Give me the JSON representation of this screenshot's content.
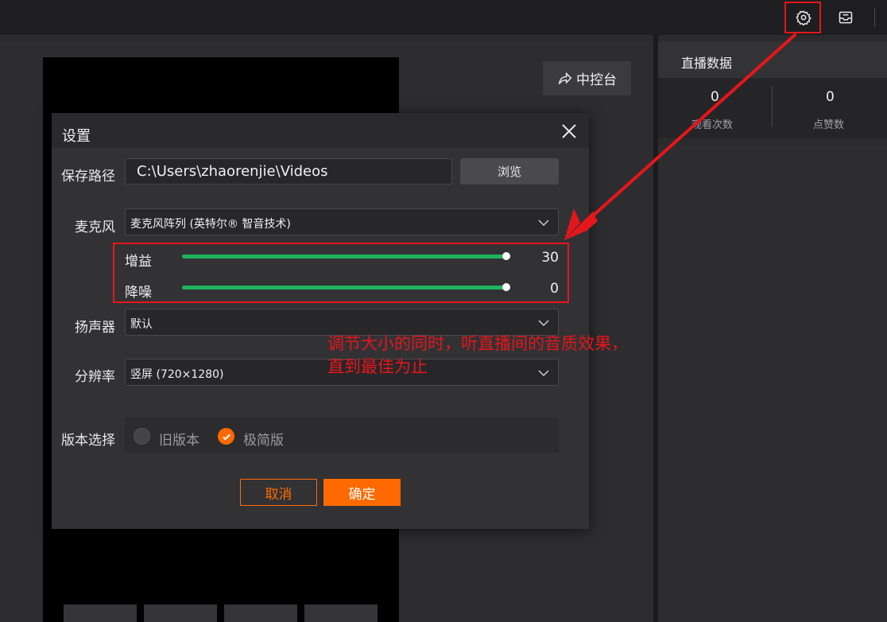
{
  "console_button": {
    "label": "中控台"
  },
  "live": {
    "title": "直播数据",
    "stats": [
      {
        "value": "0",
        "label": "观看次数"
      },
      {
        "value": "0",
        "label": "点赞数"
      }
    ]
  },
  "settings": {
    "title": "设置",
    "save_path": {
      "label": "保存路径",
      "value": "C:\\Users\\zhaorenjie\\Videos",
      "browse": "浏览"
    },
    "microphone": {
      "label": "麦克风",
      "value": "麦克风阵列 (英特尔® 智音技术)"
    },
    "gain": {
      "label": "增益",
      "value": 30
    },
    "noise": {
      "label": "降噪",
      "value": 0
    },
    "speaker": {
      "label": "扬声器",
      "value": "默认"
    },
    "resolution": {
      "label": "分辨率",
      "value": "竖屏 (720×1280)"
    },
    "version": {
      "label": "版本选择",
      "options": [
        {
          "label": "旧版本",
          "selected": false
        },
        {
          "label": "极简版",
          "selected": true
        }
      ]
    },
    "cancel": "取消",
    "confirm": "确定"
  },
  "annotation": {
    "line1": "调节大小的同时，听直播间的音质效果，",
    "line2": "直到最佳为止"
  },
  "colors": {
    "accent": "#ff6a00",
    "slider": "#1fb35d",
    "highlight": "#e5161b"
  },
  "icons": {
    "settings": "gear-icon",
    "message": "inbox-icon",
    "share": "share-arrow-icon"
  }
}
